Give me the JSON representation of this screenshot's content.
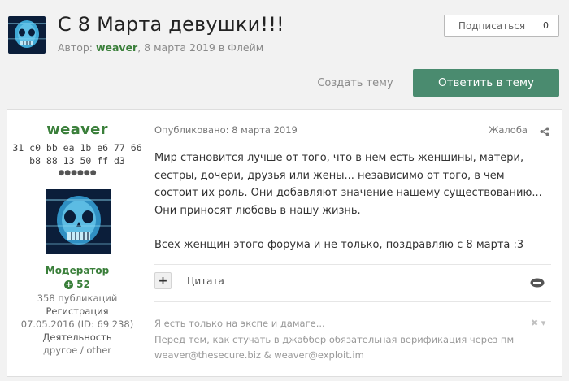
{
  "topic": {
    "title": "С 8 Марта девушки!!!",
    "meta_prefix": "Автор: ",
    "author": "weaver",
    "meta_suffix": ", 8 марта 2019 в Флейм"
  },
  "subscribe": {
    "label": "Подписаться",
    "count": "0"
  },
  "actions": {
    "create_topic": "Создать тему",
    "reply": "Ответить в тему"
  },
  "post": {
    "author": {
      "name": "weaver",
      "hex_line1": "31 c0 bb ea 1b e6 77 66",
      "hex_line2": "b8 88 13 50 ff d3",
      "rank_pips": "●●●●●●",
      "group": "Модератор",
      "reputation": "52",
      "posts": "358 публикаций",
      "registration_label": "Регистрация",
      "registration_value": "07.05.2016 (ID: 69 238)",
      "activity_label": "Деятельность",
      "activity_value": "другое / other"
    },
    "published": "Опубликовано: 8 марта 2019",
    "report": "Жалоба",
    "body_p1": "Мир становится лучше от того, что в нем есть женщины, матери, сестры, дочери, друзья или жены... независимо от того, в чем состоит их роль. Они добавляют значение нашему существованию... Они приносят любовь в нашу жизнь.",
    "body_p2": "Всех женщин этого форума и не только, поздравляю с 8 марта :3",
    "quote_label": "Цитата",
    "signature_line1": "Я есть только на экспе и дамаге...",
    "signature_line2": "Перед тем, как стучать в джаббер обязательная верификация через пм",
    "signature_line3": "weaver@thesecure.biz & weaver@exploit.im"
  },
  "colors": {
    "accent_green": "#3a7f3a",
    "reply_button": "#4a8b6f"
  }
}
